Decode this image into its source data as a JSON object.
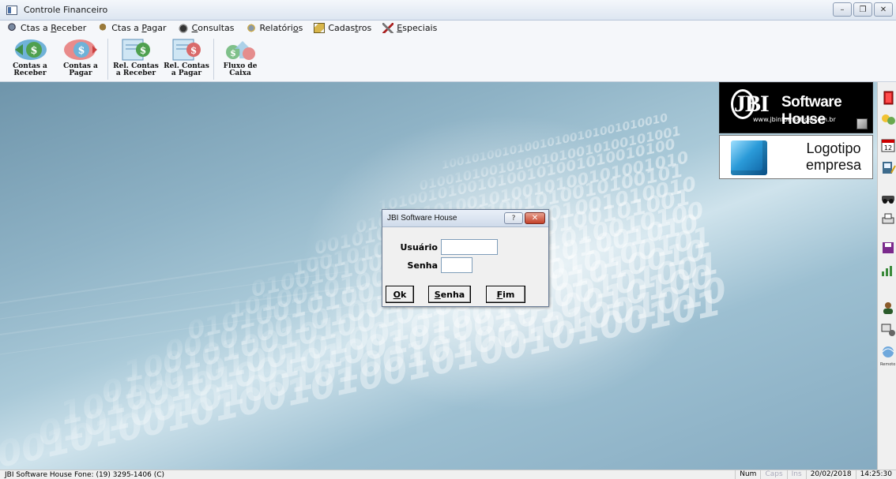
{
  "window": {
    "title": "Controle Financeiro",
    "controls": {
      "minimize": "–",
      "maximize": "❐",
      "close": "✕"
    }
  },
  "menu": [
    {
      "pre": "Ctas a ",
      "key": "R",
      "post": "eceber",
      "icon": "money-receive-icon"
    },
    {
      "pre": "Ctas a ",
      "key": "P",
      "post": "agar",
      "icon": "money-pay-icon"
    },
    {
      "pre": "",
      "key": "C",
      "post": "onsultas",
      "icon": "binoculars-icon"
    },
    {
      "pre": "Relatóri",
      "key": "o",
      "post": "s",
      "icon": "reports-icon"
    },
    {
      "pre": "Cadas",
      "key": "t",
      "post": "ros",
      "icon": "registry-icon"
    },
    {
      "pre": "",
      "key": "E",
      "post": "speciais",
      "icon": "tools-icon"
    }
  ],
  "toolbar": [
    {
      "line1": "Contas a",
      "line2": "Receber"
    },
    {
      "line1": "Contas a",
      "line2": "Pagar"
    },
    {
      "line1": "Rel. Contas",
      "line2": "a Receber"
    },
    {
      "line1": "Rel. Contas",
      "line2": "a Pagar"
    },
    {
      "line1": "Fluxo de",
      "line2": "Caixa"
    }
  ],
  "logo": {
    "letters": "JBI",
    "title": "Software House",
    "url": "www.jbinformatica.com.br"
  },
  "company_logo": {
    "line1": "Logotipo",
    "line2": "empresa"
  },
  "sidebar": {
    "last_label": "Remoto"
  },
  "dialog": {
    "title": "JBI Software House",
    "help": "?",
    "close": "✕",
    "user_label": "Usuário",
    "user_value": "",
    "password_label": "Senha",
    "password_value": "",
    "buttons": {
      "ok": {
        "key": "O",
        "rest": "k"
      },
      "senha": {
        "key": "S",
        "rest": "enha"
      },
      "fim": {
        "key": "F",
        "rest": "im"
      }
    }
  },
  "status": {
    "left": "JBI Software House Fone: (19) 3295-1406 (C)",
    "num": "Num",
    "caps": "Caps",
    "ins": "Ins",
    "date": "20/02/2018",
    "time": "14:25:30"
  },
  "colors": {
    "desktop_bg": "#8fb3c6",
    "dialog_bg": "#f0f0f0",
    "close_red": "#c4412a",
    "logo_bg": "#000000"
  }
}
